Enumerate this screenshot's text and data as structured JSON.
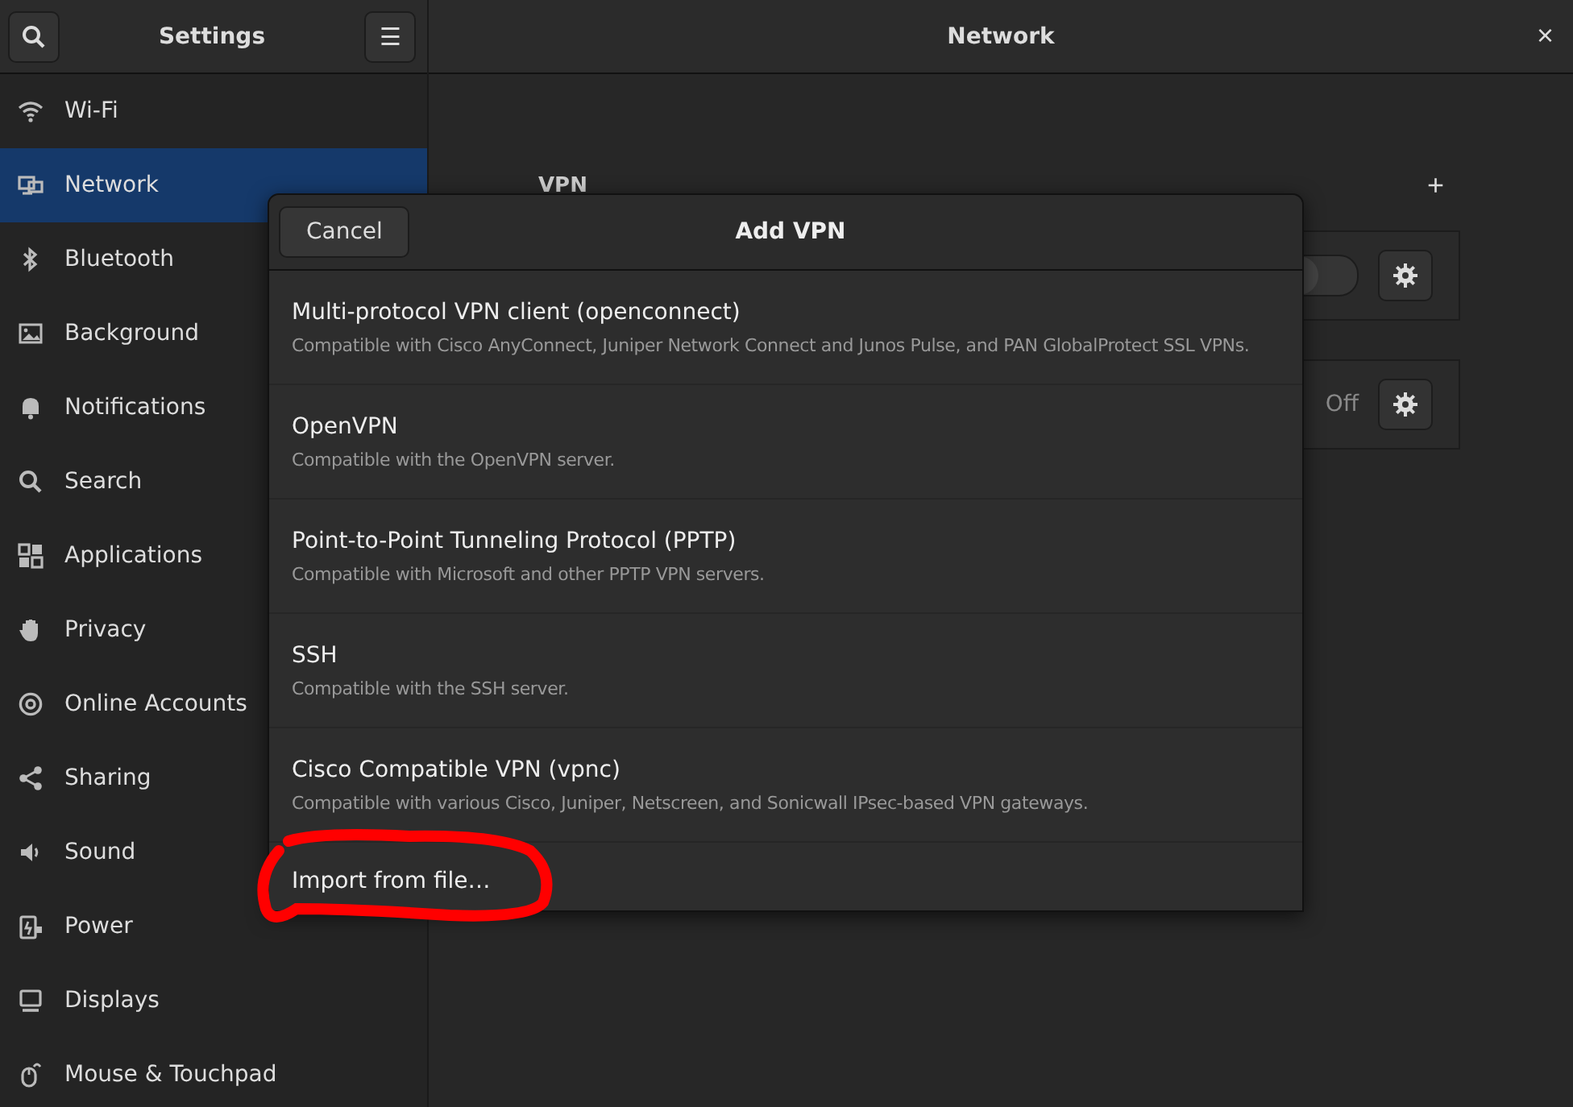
{
  "sidebar": {
    "title": "Settings",
    "menu_icon": "☰",
    "items": [
      {
        "label": "Wi-Fi",
        "selected": false
      },
      {
        "label": "Network",
        "selected": true
      },
      {
        "label": "Bluetooth",
        "selected": false
      },
      {
        "label": "Background",
        "selected": false
      },
      {
        "label": "Notifications",
        "selected": false
      },
      {
        "label": "Search",
        "selected": false
      },
      {
        "label": "Applications",
        "selected": false
      },
      {
        "label": "Privacy",
        "selected": false
      },
      {
        "label": "Online Accounts",
        "selected": false
      },
      {
        "label": "Sharing",
        "selected": false
      },
      {
        "label": "Sound",
        "selected": false
      },
      {
        "label": "Power",
        "selected": false
      },
      {
        "label": "Displays",
        "selected": false
      },
      {
        "label": "Mouse & Touchpad",
        "selected": false
      }
    ]
  },
  "main": {
    "title": "Network",
    "close": "×",
    "section_title": "VPN",
    "add": "+",
    "connections": [
      {
        "kind": "switch",
        "on": false
      },
      {
        "kind": "status",
        "status": "Off"
      }
    ]
  },
  "dialog": {
    "title": "Add VPN",
    "cancel": "Cancel",
    "options": [
      {
        "title": "Multi-protocol VPN client (openconnect)",
        "description": "Compatible with Cisco AnyConnect, Juniper Network Connect and Junos Pulse, and PAN GlobalProtect SSL VPNs."
      },
      {
        "title": "OpenVPN",
        "description": "Compatible with the OpenVPN server."
      },
      {
        "title": "Point-to-Point Tunneling Protocol (PPTP)",
        "description": "Compatible with Microsoft and other PPTP VPN servers."
      },
      {
        "title": "SSH",
        "description": "Compatible with the SSH server."
      },
      {
        "title": "Cisco Compatible VPN (vpnc)",
        "description": "Compatible with various Cisco, Juniper, Netscreen, and Sonicwall IPsec-based VPN gateways."
      },
      {
        "title": "Import from file…"
      }
    ]
  }
}
